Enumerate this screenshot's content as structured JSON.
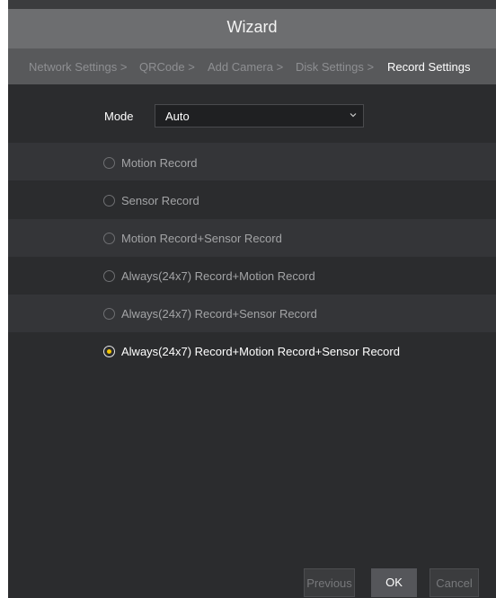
{
  "window": {
    "title": "Wizard"
  },
  "breadcrumb": {
    "items": [
      {
        "label": "Network Settings >",
        "active": false
      },
      {
        "label": "QRCode >",
        "active": false
      },
      {
        "label": "Add Camera >",
        "active": false
      },
      {
        "label": "Disk Settings >",
        "active": false
      },
      {
        "label": "Record Settings",
        "active": true
      }
    ]
  },
  "mode": {
    "label": "Mode",
    "value": "Auto",
    "icon": "chevron-down-icon"
  },
  "record_options": [
    {
      "label": "Motion Record",
      "selected": false
    },
    {
      "label": "Sensor Record",
      "selected": false
    },
    {
      "label": "Motion Record+Sensor Record",
      "selected": false
    },
    {
      "label": "Always(24x7) Record+Motion Record",
      "selected": false
    },
    {
      "label": "Always(24x7) Record+Sensor Record",
      "selected": false
    },
    {
      "label": "Always(24x7) Record+Motion Record+Sensor Record",
      "selected": true
    }
  ],
  "buttons": {
    "previous": "Previous",
    "ok": "OK",
    "cancel": "Cancel"
  },
  "colors": {
    "radio_selected_dot": "#f3c400"
  }
}
